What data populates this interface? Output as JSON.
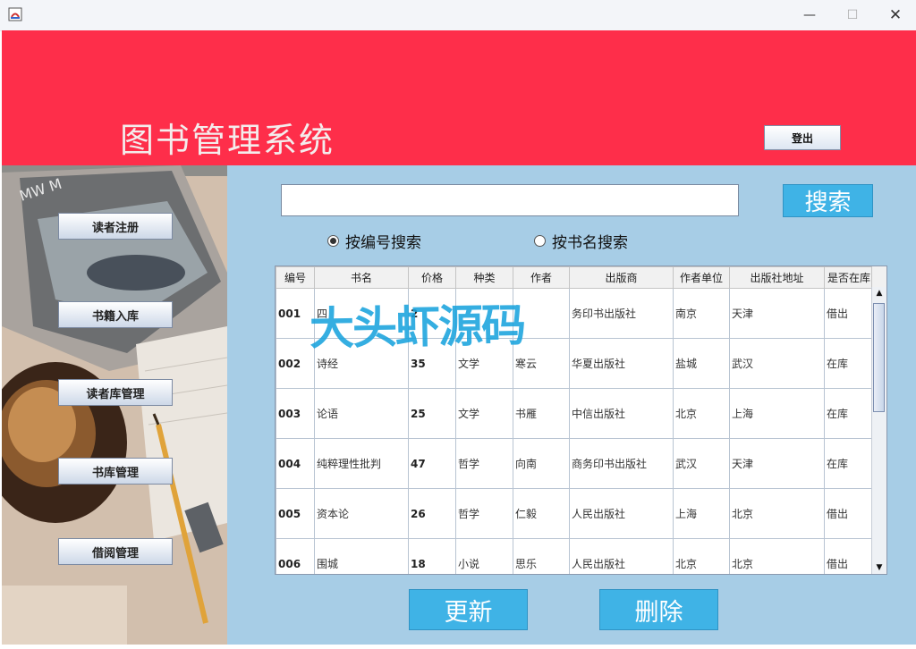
{
  "window": {
    "minimize": "—",
    "maximize": "☐",
    "close": "✕"
  },
  "header": {
    "title": "图书管理系统",
    "logout_label": "登出"
  },
  "sidebar": {
    "items": [
      {
        "label": "读者注册"
      },
      {
        "label": "书籍入库"
      },
      {
        "label": "读者库管理"
      },
      {
        "label": "书库管理"
      },
      {
        "label": "借阅管理"
      }
    ]
  },
  "search": {
    "value": "",
    "placeholder": "",
    "button_label": "搜索",
    "options": [
      {
        "label": "按编号搜索",
        "selected": true
      },
      {
        "label": "按书名搜索",
        "selected": false
      }
    ]
  },
  "table": {
    "columns": [
      "编号",
      "书名",
      "价格",
      "种类",
      "作者",
      "出版商",
      "作者单位",
      "出版社地址",
      "是否在库"
    ],
    "rows": [
      [
        "001",
        "四",
        "2",
        "",
        "",
        "务印书出版社",
        "南京",
        "天津",
        "借出"
      ],
      [
        "002",
        "诗经",
        "35",
        "文学",
        "寒云",
        "华夏出版社",
        "盐城",
        "武汉",
        "在库"
      ],
      [
        "003",
        "论语",
        "25",
        "文学",
        "书雁",
        "中信出版社",
        "北京",
        "上海",
        "在库"
      ],
      [
        "004",
        "纯粹理性批判",
        "47",
        "哲学",
        "向南",
        "商务印书出版社",
        "武汉",
        "天津",
        "在库"
      ],
      [
        "005",
        "资本论",
        "26",
        "哲学",
        "仁毅",
        "人民出版社",
        "上海",
        "北京",
        "借出"
      ],
      [
        "006",
        "围城",
        "18",
        "小说",
        "思乐",
        "人民出版社",
        "北京",
        "北京",
        "借出"
      ]
    ]
  },
  "actions": {
    "update_label": "更新",
    "delete_label": "删除"
  },
  "watermark": "大头虾源码",
  "colors": {
    "header": "#fe2e4a",
    "panel": "#a7cde6",
    "accent_button": "#3fb3e6"
  }
}
